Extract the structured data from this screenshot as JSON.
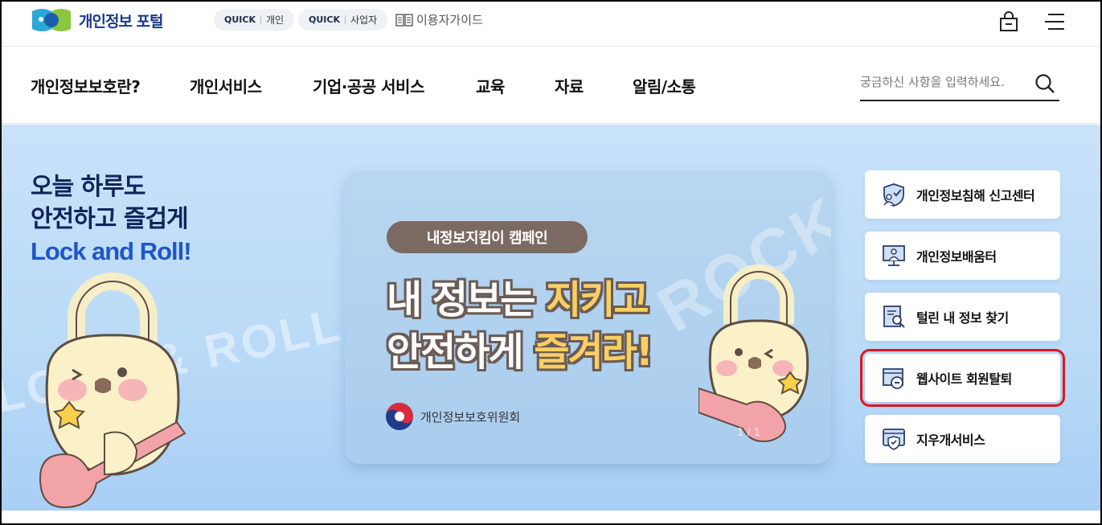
{
  "header": {
    "logo_text": "개인정보 포털",
    "quick_personal": {
      "tag": "QUICK",
      "label": "개인"
    },
    "quick_business": {
      "tag": "QUICK",
      "label": "사업자"
    },
    "guide_label": "이용자가이드"
  },
  "gnb": {
    "items": [
      "개인정보보호란?",
      "개인서비스",
      "기업·공공 서비스",
      "교육",
      "자료",
      "알림/소통"
    ],
    "search_placeholder": "궁금하신 사항을 입력하세요."
  },
  "hero": {
    "line1": "오늘 하루도",
    "line2": "안전하고 즐겁게",
    "line3": "Lock and Roll!",
    "banner": {
      "pill": "내정보지킴이 캠페인",
      "headline1_a": "내 정보는 ",
      "headline1_b": "지키고",
      "headline2_a": "안전하게 ",
      "headline2_b": "즐겨라!",
      "org": "개인정보보호위원회",
      "pager": "1 / 1"
    }
  },
  "quick_links": [
    {
      "label": "개인정보침해 신고센터",
      "icon": "shield-person-icon"
    },
    {
      "label": "개인정보배움터",
      "icon": "monitor-teacher-icon"
    },
    {
      "label": "털린 내 정보 찾기",
      "icon": "document-search-icon"
    },
    {
      "label": "웹사이트 회원탈퇴",
      "icon": "web-withdraw-icon"
    },
    {
      "label": "지우개서비스",
      "icon": "eraser-shield-icon"
    }
  ],
  "colors": {
    "brand_navy": "#1d3a8a",
    "accent_blue": "#1f56c8",
    "highlight_red": "#e0161d",
    "hero_bg": "#b9daf7"
  }
}
